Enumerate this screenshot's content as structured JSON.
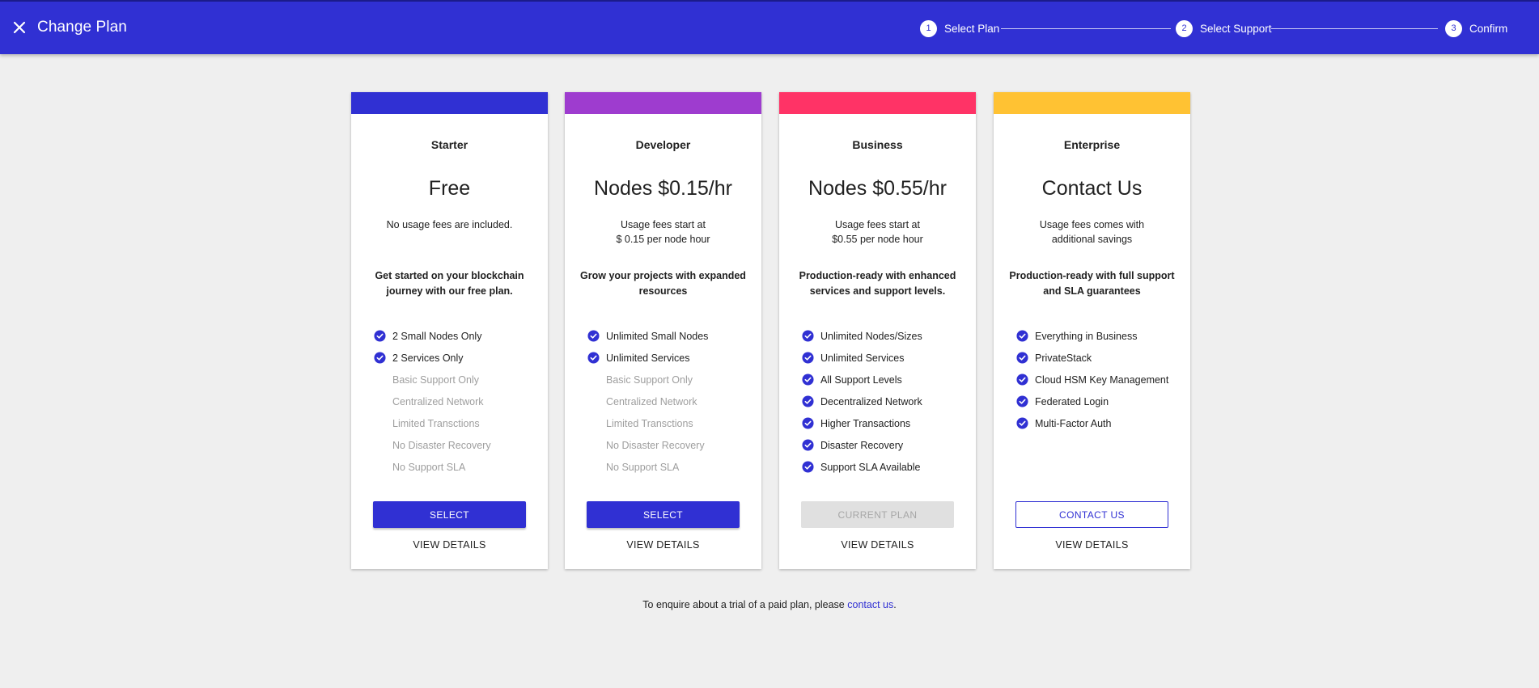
{
  "header": {
    "title": "Change Plan",
    "close_icon": "close-icon",
    "background": "#3030d3"
  },
  "stepper": {
    "steps": [
      {
        "number": "1",
        "label": "Select Plan"
      },
      {
        "number": "2",
        "label": "Select Support"
      },
      {
        "number": "3",
        "label": "Confirm"
      }
    ]
  },
  "plans": [
    {
      "name": "Starter",
      "price": "Free",
      "fee": "No usage fees are included.",
      "description": "Get started on your blockchain journey with our free plan.",
      "color": "#3030d3",
      "features": [
        {
          "label": "2 Small Nodes Only",
          "included": true
        },
        {
          "label": "2 Services Only",
          "included": true
        },
        {
          "label": "Basic Support Only",
          "included": false
        },
        {
          "label": "Centralized Network",
          "included": false
        },
        {
          "label": "Limited Transctions",
          "included": false
        },
        {
          "label": "No Disaster Recovery",
          "included": false
        },
        {
          "label": "No Support SLA",
          "included": false
        }
      ],
      "button": "SELECT",
      "button_style": "primary",
      "details": "VIEW DETAILS"
    },
    {
      "name": "Developer",
      "price": "Nodes $0.15/hr",
      "fee": "Usage fees start at\n$ 0.15 per node hour",
      "description": "Grow your projects with expanded resources",
      "color": "#9e3ccf",
      "features": [
        {
          "label": "Unlimited Small Nodes",
          "included": true
        },
        {
          "label": "Unlimited Services",
          "included": true
        },
        {
          "label": "Basic Support Only",
          "included": false
        },
        {
          "label": "Centralized Network",
          "included": false
        },
        {
          "label": "Limited Transctions",
          "included": false
        },
        {
          "label": "No Disaster Recovery",
          "included": false
        },
        {
          "label": "No Support SLA",
          "included": false
        }
      ],
      "button": "SELECT",
      "button_style": "primary",
      "details": "VIEW DETAILS"
    },
    {
      "name": "Business",
      "price": "Nodes $0.55/hr",
      "fee": "Usage fees start at\n$0.55 per node hour",
      "description": "Production-ready with enhanced services and support levels.",
      "color": "#ff3366",
      "features": [
        {
          "label": "Unlimited Nodes/Sizes",
          "included": true
        },
        {
          "label": "Unlimited Services",
          "included": true
        },
        {
          "label": "All Support Levels",
          "included": true
        },
        {
          "label": "Decentralized Network",
          "included": true
        },
        {
          "label": "Higher Transactions",
          "included": true
        },
        {
          "label": "Disaster Recovery",
          "included": true
        },
        {
          "label": "Support SLA Available",
          "included": true
        }
      ],
      "button": "CURRENT PLAN",
      "button_style": "disabled",
      "details": "VIEW DETAILS"
    },
    {
      "name": "Enterprise",
      "price": "Contact Us",
      "fee": "Usage fees comes with\nadditional savings",
      "description": "Production-ready with full support and SLA guarantees",
      "color": "#ffc233",
      "features": [
        {
          "label": "Everything in Business",
          "included": true
        },
        {
          "label": "PrivateStack",
          "included": true
        },
        {
          "label": "Cloud HSM Key Management",
          "included": true
        },
        {
          "label": "Federated Login",
          "included": true
        },
        {
          "label": "Multi-Factor Auth",
          "included": true
        }
      ],
      "button": "CONTACT US",
      "button_style": "outline",
      "details": "VIEW DETAILS"
    }
  ],
  "footer": {
    "text": "To enquire about a trial of a paid plan, please ",
    "link": "contact us",
    "suffix": "."
  },
  "icons": {
    "included": "check-circle-icon"
  },
  "colors": {
    "accent": "#3030d3",
    "page_background": "#efefef",
    "disabled_text": "#9e9e9e"
  }
}
